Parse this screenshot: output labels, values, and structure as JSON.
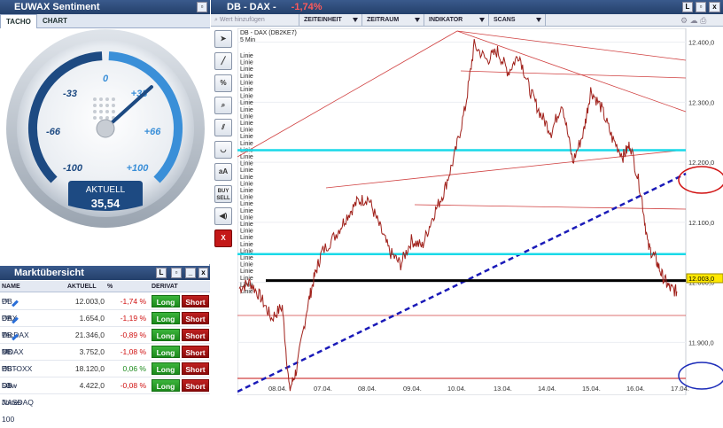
{
  "sentiment": {
    "title": "EUWAX Sentiment",
    "tabs": [
      "TACHO",
      "CHART"
    ],
    "scale_labels": [
      "-100",
      "-66",
      "-33",
      "0",
      "+33",
      "+66",
      "+100"
    ],
    "current_label": "AKTUELL",
    "current_value": "35,54",
    "needle_value": 35.54
  },
  "market": {
    "title": "Marktübersicht",
    "columns": [
      "NAME",
      "AKTUELL",
      "%",
      "DERIVAT"
    ],
    "rows": [
      {
        "name": "DB - DAX",
        "sup": "DB",
        "value": "12.003,0",
        "pct": "-1,74 %",
        "dir": "neg",
        "pen": true
      },
      {
        "name": "DB - TecDAX",
        "sup": "DB",
        "value": "1.654,0",
        "pct": "-1,19 %",
        "dir": "neg",
        "pen": true
      },
      {
        "name": "DB - MDAX",
        "sup": "DB",
        "value": "21.346,0",
        "pct": "-0,89 %",
        "dir": "neg",
        "pen": true
      },
      {
        "name": "DB - ESTOXX 50",
        "sup": "DB",
        "value": "3.752,0",
        "pct": "-1,08 %",
        "dir": "neg",
        "pen": false
      },
      {
        "name": "DB - Dow Jones",
        "sup": "DB",
        "value": "18.120,0",
        "pct": "0,06 %",
        "dir": "pos",
        "pen": false
      },
      {
        "name": "DB - NASDAQ 100",
        "sup": "I",
        "value": "4.422,0",
        "pct": "-0,08 %",
        "dir": "neg",
        "pen": false
      }
    ],
    "long_label": "Long",
    "short_label": "Short"
  },
  "chart_window": {
    "title": "DB - DAX -",
    "change": "-1,74%",
    "add_value_placeholder": "Wert hinzufügen",
    "toolbar": [
      "ZEITEINHEIT",
      "ZEITRAUM",
      "INDIKATOR",
      "SCANS"
    ],
    "tools": [
      "cursor",
      "line",
      "percent",
      "zoom",
      "parallel",
      "curve",
      "aA",
      "BUY SELL",
      "sound",
      "X"
    ],
    "instrument_label": "DB - DAX (DB2KE7)",
    "interval_label": "5 Min",
    "line_label": "Linie",
    "last_price": "12.003,0"
  },
  "chart_data": {
    "type": "line",
    "x_ticks": [
      "08.04.",
      "07.04.",
      "08.04.",
      "09.04.",
      "10.04.",
      "13.04.",
      "14.04.",
      "15.04.",
      "16.04.",
      "17.04."
    ],
    "y_ticks": [
      "12.400,0",
      "12.300,0",
      "12.200,0",
      "12.100,0",
      "12.000,0",
      "11.900,0"
    ],
    "ylim": [
      11815,
      12420
    ],
    "price_path": [
      [
        0,
        11990
      ],
      [
        0.3,
        12000
      ],
      [
        0.6,
        11975
      ],
      [
        0.9,
        11940
      ],
      [
        1.2,
        11960
      ],
      [
        1.4,
        11820
      ],
      [
        1.6,
        11855
      ],
      [
        1.9,
        11960
      ],
      [
        2.1,
        12010
      ],
      [
        2.3,
        12050
      ],
      [
        2.7,
        12080
      ],
      [
        3.0,
        12110
      ],
      [
        3.3,
        12135
      ],
      [
        3.6,
        12140
      ],
      [
        3.9,
        12095
      ],
      [
        4.2,
        12050
      ],
      [
        4.5,
        12030
      ],
      [
        4.8,
        12070
      ],
      [
        5.1,
        12060
      ],
      [
        5.4,
        12110
      ],
      [
        5.7,
        12150
      ],
      [
        6.0,
        12210
      ],
      [
        6.3,
        12290
      ],
      [
        6.55,
        12395
      ],
      [
        6.9,
        12370
      ],
      [
        7.2,
        12385
      ],
      [
        7.5,
        12350
      ],
      [
        7.8,
        12380
      ],
      [
        8.1,
        12320
      ],
      [
        8.4,
        12280
      ],
      [
        8.7,
        12250
      ],
      [
        9.0,
        12300
      ],
      [
        9.3,
        12200
      ],
      [
        9.6,
        12250
      ],
      [
        9.8,
        12320
      ],
      [
        10.1,
        12290
      ],
      [
        10.4,
        12240
      ],
      [
        10.7,
        12210
      ],
      [
        10.9,
        12230
      ],
      [
        11.2,
        12150
      ],
      [
        11.4,
        12060
      ],
      [
        11.6,
        12040
      ],
      [
        11.8,
        12010
      ],
      [
        12.0,
        11990
      ],
      [
        12.2,
        11985
      ]
    ],
    "horizontal_lines": [
      {
        "y": 12220,
        "color": "#19d9e8"
      },
      {
        "y": 12047,
        "color": "#19d9e8"
      },
      {
        "y": 12003,
        "color": "#000000"
      }
    ]
  }
}
